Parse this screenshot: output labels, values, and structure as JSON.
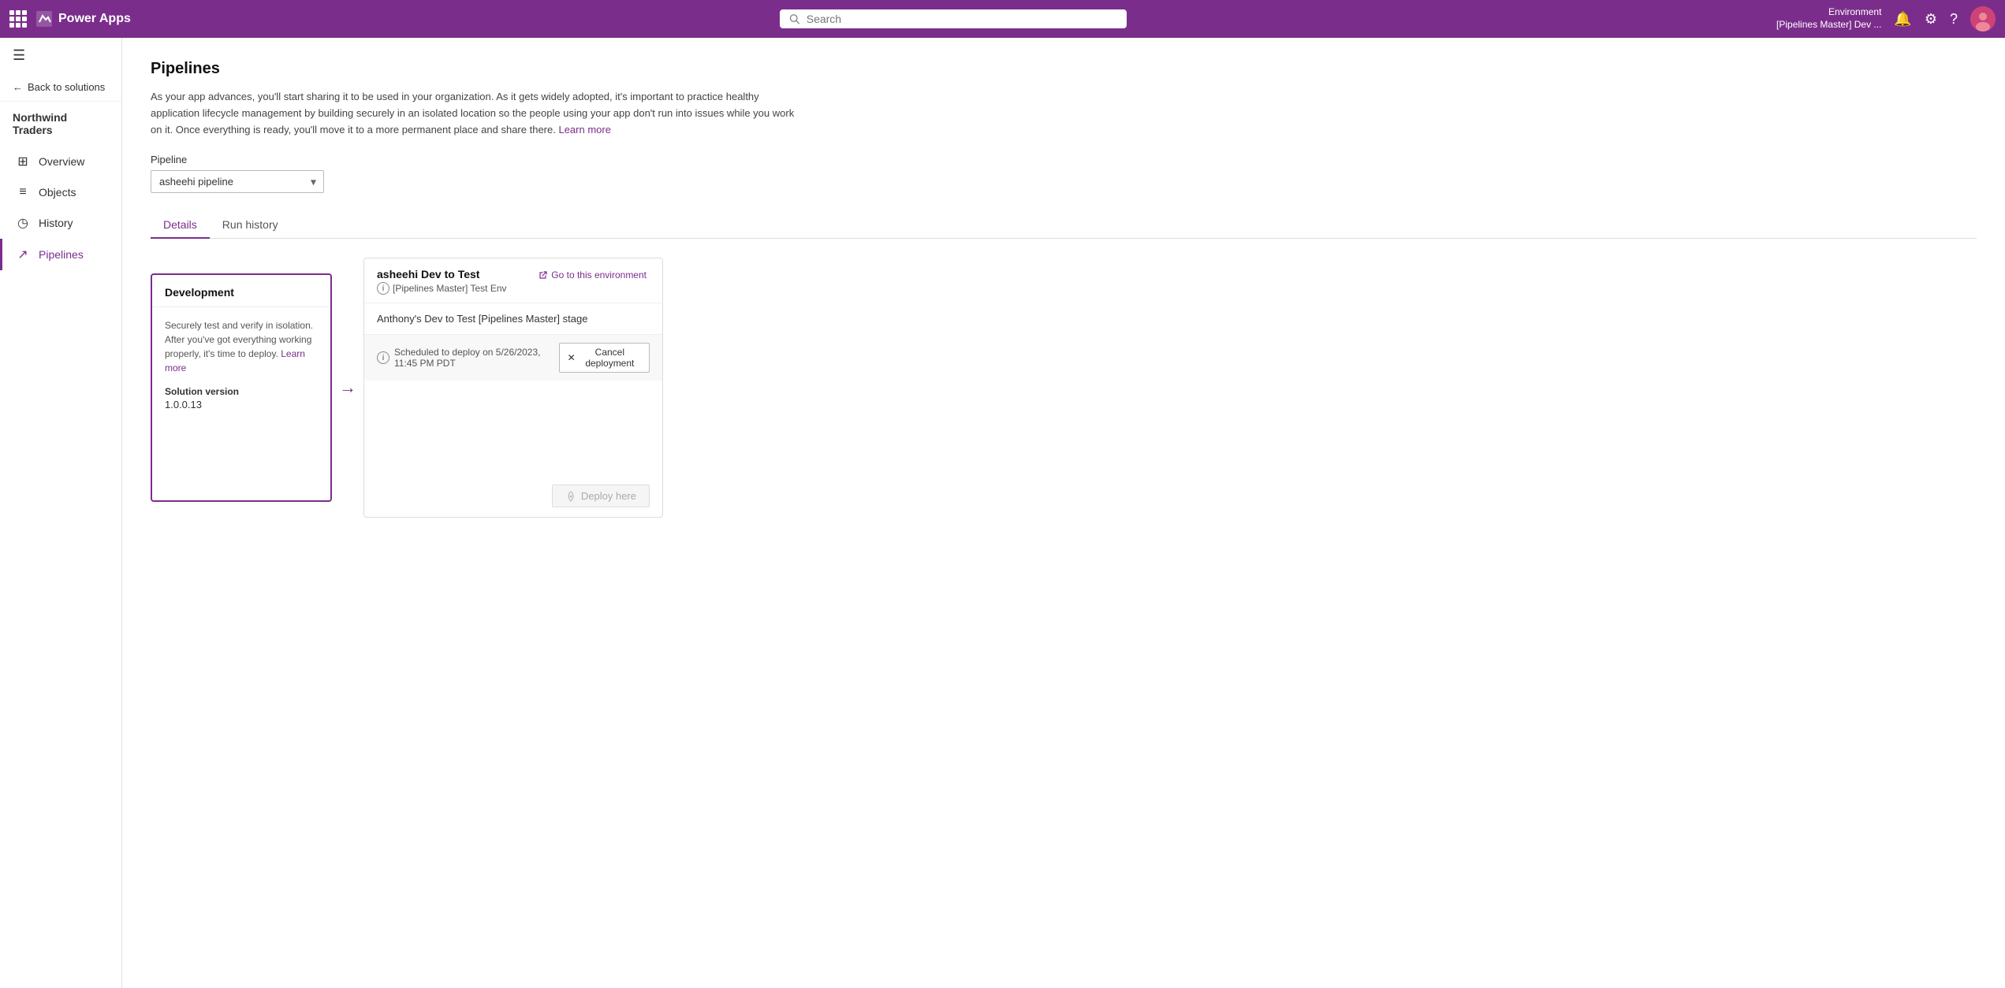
{
  "topbar": {
    "app_name": "Power Apps",
    "search_placeholder": "Search",
    "environment_label": "Environment",
    "environment_name": "[Pipelines Master] Dev ...",
    "waffle_icon": "waffle"
  },
  "sidebar": {
    "back_label": "Back to solutions",
    "app_name": "Northwind Traders",
    "nav_items": [
      {
        "id": "overview",
        "label": "Overview",
        "icon": "⊞",
        "active": false
      },
      {
        "id": "objects",
        "label": "Objects",
        "icon": "≡",
        "active": false
      },
      {
        "id": "history",
        "label": "History",
        "icon": "◷",
        "active": false
      },
      {
        "id": "pipelines",
        "label": "Pipelines",
        "icon": "↗",
        "active": true
      }
    ]
  },
  "main": {
    "page_title": "Pipelines",
    "description": "As your app advances, you'll start sharing it to be used in your organization. As it gets widely adopted, it's important to practice healthy application lifecycle management by building securely in an isolated location so the people using your app don't run into issues while you work on it. Once everything is ready, you'll move it to a more permanent place and share there.",
    "learn_more_label": "Learn more",
    "pipeline_label": "Pipeline",
    "pipeline_selected": "asheehi pipeline",
    "tabs": [
      {
        "id": "details",
        "label": "Details",
        "active": true
      },
      {
        "id": "run-history",
        "label": "Run history",
        "active": false
      }
    ],
    "development_stage": {
      "name": "Development",
      "description": "Securely test and verify in isolation. After you've got everything working properly, it's time to deploy.",
      "learn_more_label": "Learn more",
      "solution_version_label": "Solution version",
      "solution_version": "1.0.0.13"
    },
    "arrow": "→",
    "deployment_stage": {
      "title": "asheehi Dev to Test",
      "env_icon": "ℹ",
      "env_name": "[Pipelines Master] Test Env",
      "go_to_env_label": "Go to this environment",
      "stage_name": "Anthony's Dev to Test [Pipelines Master] stage",
      "scheduled_info_icon": "ℹ",
      "scheduled_text": "Scheduled to deploy on 5/26/2023, 11:45 PM PDT",
      "cancel_label": "Cancel deployment",
      "deploy_here_label": "Deploy here"
    }
  }
}
